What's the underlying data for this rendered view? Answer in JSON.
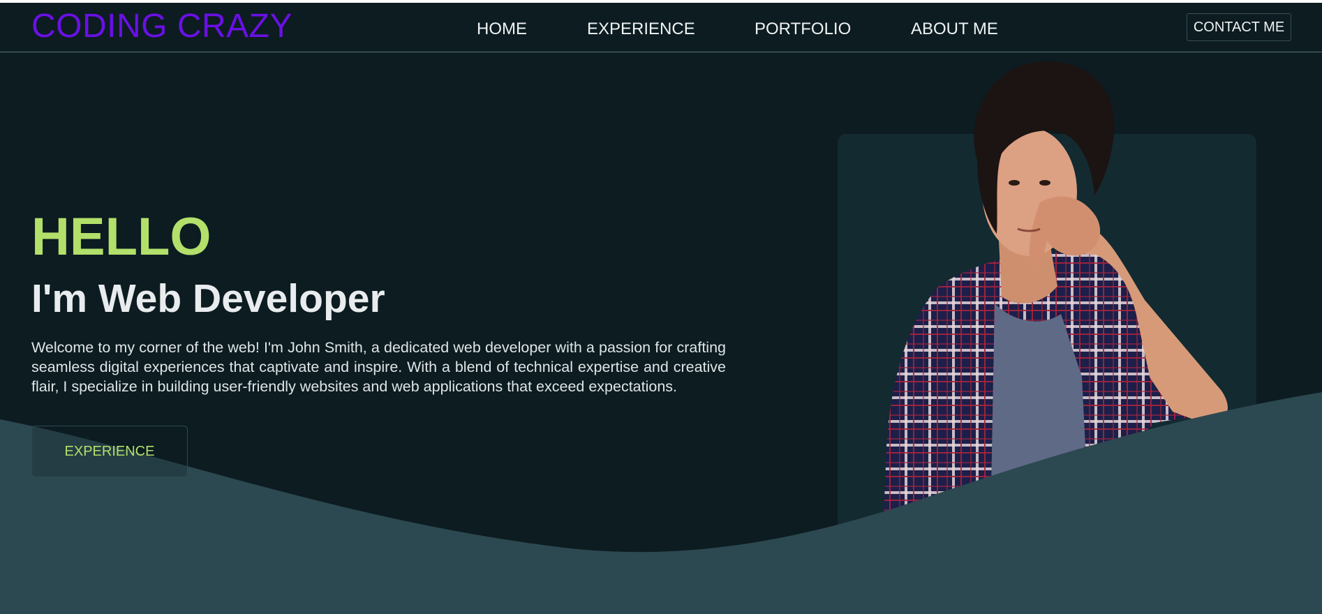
{
  "brand": {
    "name": "CODING CRAZY",
    "color": "#6a10e6"
  },
  "nav": {
    "items": [
      {
        "label": "HOME"
      },
      {
        "label": "EXPERIENCE"
      },
      {
        "label": "PORTFOLIO"
      },
      {
        "label": "ABOUT ME"
      }
    ],
    "contact_label": "CONTACT ME"
  },
  "hero": {
    "greeting": "HELLO",
    "role": "I'm Web Developer",
    "intro": "Welcome to my corner of the web! I'm John Smith, a dedicated web developer with a passion for crafting seamless digital experiences that captivate and inspire. With a blend of technical expertise and creative flair, I specialize in building user-friendly websites and web applications that exceed expectations.",
    "cta_label": "EXPERIENCE",
    "portrait_icon": "person-portrait-icon"
  },
  "colors": {
    "background": "#0c1c21",
    "wave": "#2c4850",
    "panel": "#132a31",
    "accent": "#b3e06a",
    "text": "#e9ecee"
  }
}
